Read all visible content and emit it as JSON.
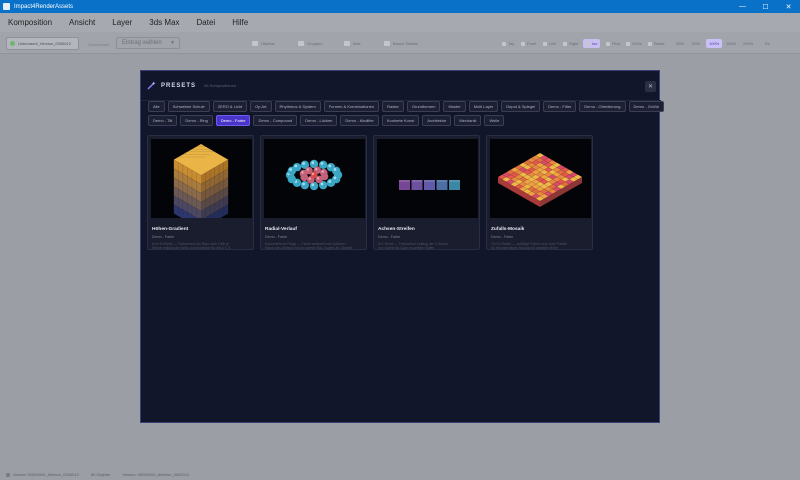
{
  "window": {
    "title": "Impact4RenderAssets",
    "controls": [
      "—",
      "☐",
      "✕"
    ]
  },
  "menu": [
    "Komposition",
    "Ansicht",
    "Layer",
    "3ds Max",
    "Datei",
    "Hilfe"
  ],
  "toolbar": {
    "project": "Unbenannt_Version_0000012",
    "label": "Schnellwahl",
    "dropdown": "Eintrag wählen",
    "tools": [
      "Objekte",
      "Gruppen",
      "Max",
      "Bauch Tabelle"
    ],
    "view_buttons": [
      "Top",
      "Front",
      "Left",
      "Right",
      "Iso",
      "Pers",
      "Ortho",
      "Reset"
    ],
    "active_view": "Iso",
    "zoom": [
      "25%",
      "50%",
      "100%",
      "150%",
      "200%",
      "Fit"
    ],
    "active_zoom": "100%"
  },
  "modal": {
    "title": "PRESETS",
    "count": "36 Kompositionen",
    "close": "✕",
    "category_rows": [
      [
        "Alle",
        "Schwebee Schule",
        "ZERO & Licht",
        "Op Art",
        "Rhythmus & System",
        "Formen & Kombinationen",
        "Raster",
        "Grundformen",
        "Muster",
        "Multi Layer",
        "Depot & Spiegel",
        "Demo - Filter",
        "Demo - Orientierung",
        "Demo - Größe"
      ],
      [
        "Demo - Tilt",
        "Demo - Ring",
        "Demo - Farbe",
        "Demo - Compound",
        "Demo - Lücken",
        "Demo - Modifier",
        "Konkrete Kunst",
        "Architektur",
        "Mechanik",
        "Welle"
      ]
    ],
    "active_category": "Demo - Farbe",
    "presets": [
      {
        "name": "Höhen-Gradient",
        "tag": "Demo - Farbe",
        "desc": [
          "6×6×6 Würfel — Farbverlauf von Blau nach Gelb je",
          "Ebene entlang der Höhe, kontinuierlich für die A C S"
        ]
      },
      {
        "name": "Radial-Verlauf",
        "tag": "Demo - Farbe",
        "desc": [
          "Konzentrische Ringe — Farbe wechselt vom äußeren",
          "Rand zum Zentrum hin ins warme Rot, Kugeln als Objekte"
        ]
      },
      {
        "name": "Achsen-Streifen",
        "tag": "Demo - Farbe",
        "desc": [
          "5×1 Reihe — Farbverlauf entlang der X-Achse",
          "von Violett bis Cyan in sanften Stufen"
        ]
      },
      {
        "name": "Zufalls-Mosaik",
        "tag": "Demo - Farbe",
        "desc": [
          "10×10 Raster — zufällige Farben aus einer Palette",
          "für ein lebendiges Mosaik mit variabler Höhe"
        ]
      }
    ]
  },
  "status": {
    "items": [
      "Version 00000000_Ableton_0000012",
      "80 Objekte",
      "Version: 00000000_Ableton_0000012"
    ]
  }
}
